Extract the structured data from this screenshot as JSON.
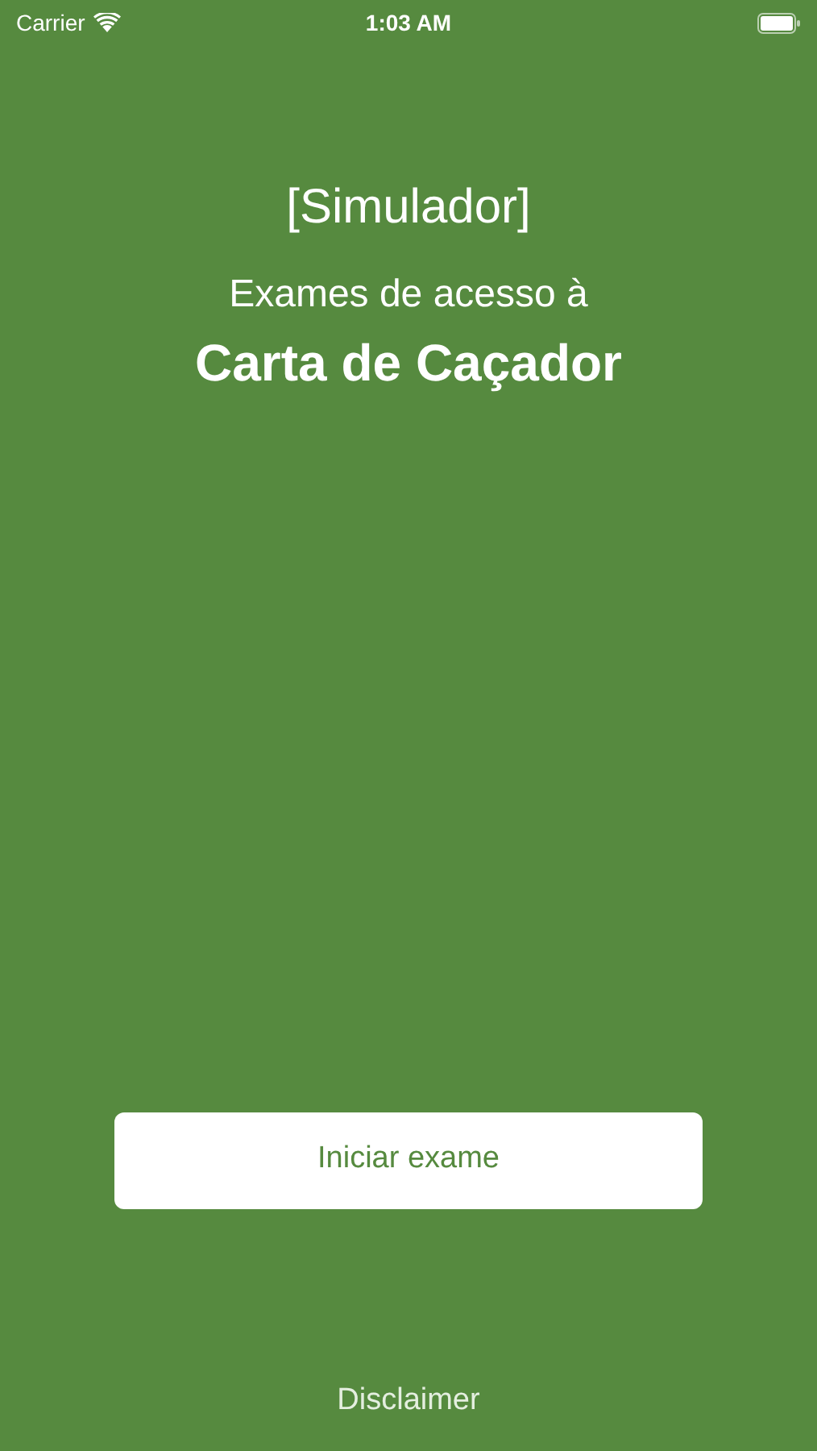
{
  "status_bar": {
    "carrier": "Carrier",
    "time": "1:03 AM"
  },
  "header": {
    "tag": "[Simulador]",
    "subtitle": "Exames de acesso à",
    "title": "Carta de Caçador"
  },
  "start_button": {
    "label": "Iniciar exame"
  },
  "footer_link": {
    "label": "Disclaimer"
  }
}
